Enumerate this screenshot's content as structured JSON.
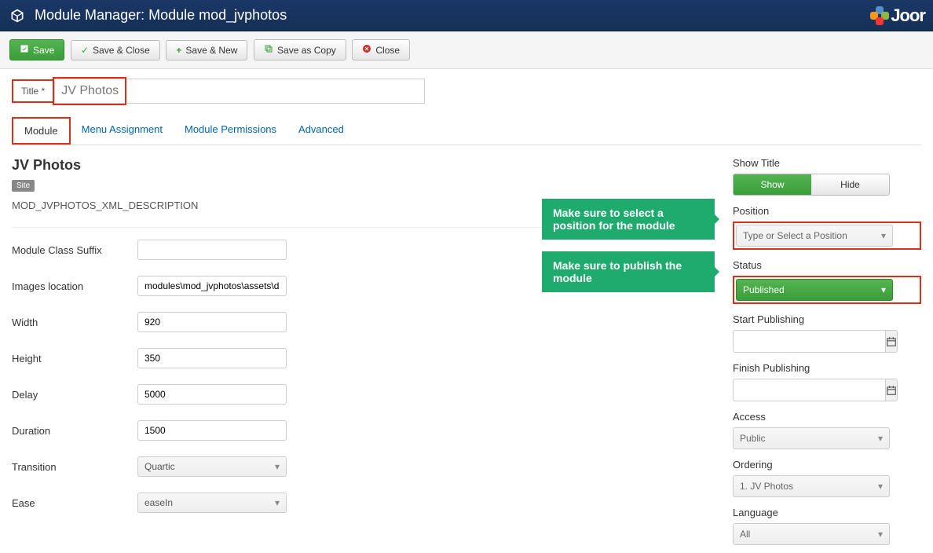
{
  "header": {
    "title": "Module Manager: Module mod_jvphotos",
    "logo_text": "Joor"
  },
  "toolbar": {
    "save": "Save",
    "save_close": "Save & Close",
    "save_new": "Save & New",
    "save_copy": "Save as Copy",
    "close": "Close"
  },
  "title_field": {
    "label": "Title *",
    "value": "JV Photos"
  },
  "tabs": {
    "module": "Module",
    "menu_assignment": "Menu Assignment",
    "module_permissions": "Module Permissions",
    "advanced": "Advanced"
  },
  "module_info": {
    "name": "JV Photos",
    "badge": "Site",
    "description": "MOD_JVPHOTOS_XML_DESCRIPTION"
  },
  "params": {
    "module_class_suffix_label": "Module Class Suffix",
    "module_class_suffix_value": "",
    "images_location_label": "Images location",
    "images_location_value": "modules\\mod_jvphotos\\assets\\da",
    "width_label": "Width",
    "width_value": "920",
    "height_label": "Height",
    "height_value": "350",
    "delay_label": "Delay",
    "delay_value": "5000",
    "duration_label": "Duration",
    "duration_value": "1500",
    "transition_label": "Transition",
    "transition_value": "Quartic",
    "ease_label": "Ease",
    "ease_value": "easeIn"
  },
  "sidebar": {
    "show_title_label": "Show Title",
    "show": "Show",
    "hide": "Hide",
    "position_label": "Position",
    "position_placeholder": "Type or Select a Position",
    "status_label": "Status",
    "status_value": "Published",
    "start_publishing_label": "Start Publishing",
    "finish_publishing_label": "Finish Publishing",
    "access_label": "Access",
    "access_value": "Public",
    "ordering_label": "Ordering",
    "ordering_value": "1. JV Photos",
    "language_label": "Language",
    "language_value": "All"
  },
  "callouts": {
    "position": "Make sure to select a position for the module",
    "publish": "Make sure to publish the module"
  }
}
